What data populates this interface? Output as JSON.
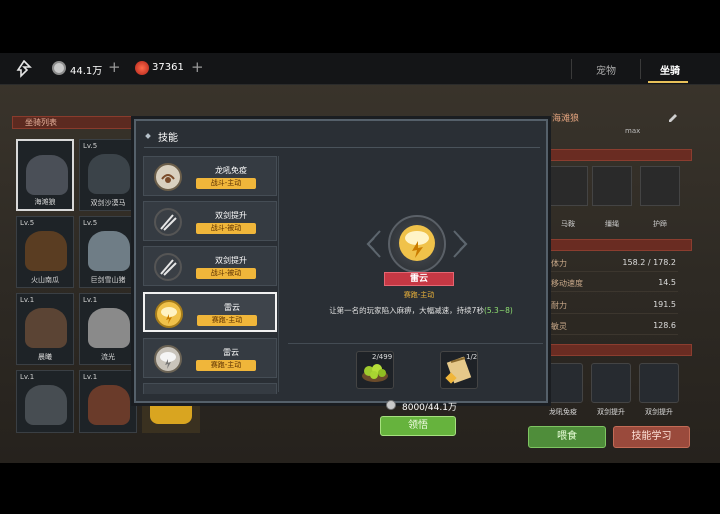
{
  "topbar": {
    "resource1": {
      "icon": "silver-coin-icon",
      "value": "44.1万"
    },
    "resource2": {
      "icon": "red-gem-icon",
      "value": "37361"
    },
    "tabs": [
      {
        "label": "宠物",
        "active": false
      },
      {
        "label": "坐骑",
        "active": true
      }
    ]
  },
  "mount_list": {
    "title": "坐骑列表",
    "cards": [
      {
        "level": "",
        "name": "海滩狼"
      },
      {
        "level": "Lv.5",
        "name": "双剑沙漠马"
      },
      {
        "level": "Lv.5",
        "name": "火山南瓜"
      },
      {
        "level": "Lv.5",
        "name": "巨剑雪山猪"
      },
      {
        "level": "Lv.1",
        "name": "晨曦"
      },
      {
        "level": "Lv.1",
        "name": "流光"
      },
      {
        "level": "Lv.1",
        "name": ""
      },
      {
        "level": "Lv.1",
        "name": ""
      }
    ]
  },
  "detail": {
    "mount_name": "海滩狼",
    "rank": "max",
    "equip_labels": [
      "马鞍",
      "缰绳",
      "护蹄"
    ],
    "stats": [
      {
        "key": "体力",
        "value": "158.2 / 178.2"
      },
      {
        "key": "移动速度",
        "value": "14.5"
      },
      {
        "key": "耐力",
        "value": "191.5"
      },
      {
        "key": "敏灵",
        "value": "128.6"
      }
    ],
    "skill_labels": [
      "龙吼免疫",
      "双剑提升",
      "双剑提升"
    ],
    "feed_button": "喂食",
    "learn_button": "技能学习"
  },
  "modal": {
    "title": "技能",
    "skills": [
      {
        "name": "龙吼免疫",
        "tag": "战斗-主动",
        "icon": "roar-icon",
        "selected": false
      },
      {
        "name": "双剑提升",
        "tag": "战斗-被动",
        "icon": "twin-swords-icon",
        "selected": false
      },
      {
        "name": "双剑提升",
        "tag": "战斗-被动",
        "icon": "twin-swords-icon",
        "selected": false
      },
      {
        "name": "雷云",
        "tag": "赛跑-主动",
        "icon": "thundercloud-icon",
        "selected": true
      },
      {
        "name": "雷云",
        "tag": "赛跑-主动",
        "icon": "thundercloud-icon",
        "selected": false
      }
    ],
    "selected_skill": {
      "name": "雷云",
      "type": "赛跑-主动",
      "description_main": "让第一名的玩家陷入麻痹，大幅减速，持续7秒",
      "description_range": "(5.3~8)"
    },
    "materials": [
      {
        "icon": "green-fruit-bowl-icon",
        "count": "2/499"
      },
      {
        "icon": "skill-scroll-icon",
        "count": "1/2"
      }
    ],
    "cost": "8000/44.1万",
    "comprehend_button": "领悟"
  },
  "colors": {
    "tag_gold": "#f0b63a",
    "skill_name_red": "#c63844",
    "green_button": "#66b33d",
    "highlight_green": "#8fe071"
  }
}
